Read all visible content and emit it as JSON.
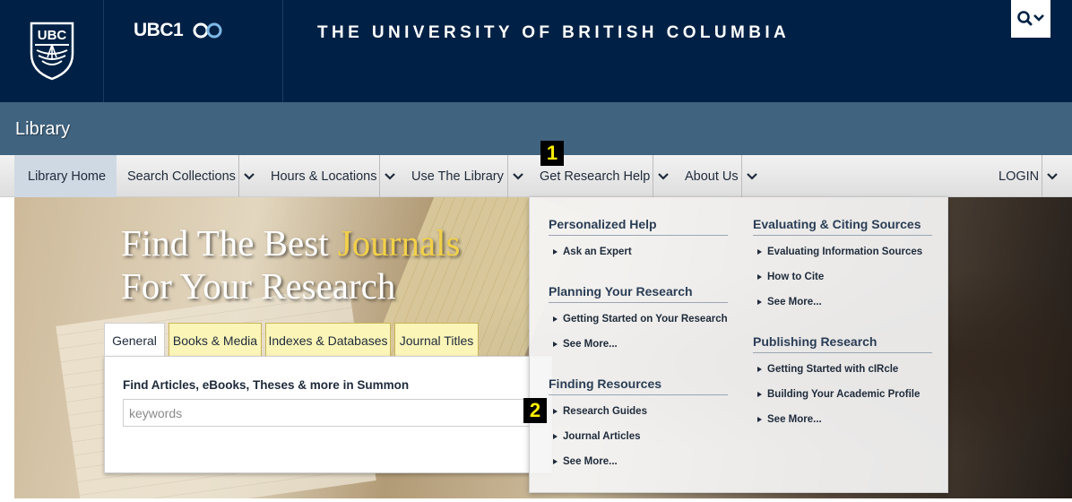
{
  "header": {
    "crest_text": "UBC",
    "ubc100_text": "UBC1",
    "university_title": "THE UNIVERSITY OF BRITISH COLUMBIA"
  },
  "library_bar": {
    "title": "Library"
  },
  "nav": {
    "items": [
      {
        "label": "Library Home"
      },
      {
        "label": "Search Collections"
      },
      {
        "label": "Hours & Locations"
      },
      {
        "label": "Use The Library"
      },
      {
        "label": "Get Research Help"
      },
      {
        "label": "About Us"
      }
    ],
    "login": "LOGIN"
  },
  "callouts": {
    "one": "1",
    "two": "2"
  },
  "hero": {
    "line1_start": "Find The Best ",
    "line1_highlight": "Journals",
    "line2": "For Your Research"
  },
  "search": {
    "tabs": [
      "General",
      "Books & Media",
      "Indexes & Databases",
      "Journal Titles"
    ],
    "label": "Find Articles, eBooks, Theses & more in Summon",
    "placeholder": "keywords"
  },
  "dropdown": {
    "personalized_help": {
      "heading": "Personalized Help",
      "links": [
        "Ask an Expert"
      ]
    },
    "planning_research": {
      "heading": "Planning Your Research",
      "links": [
        "Getting Started on Your Research",
        "See More..."
      ]
    },
    "finding_resources": {
      "heading": "Finding Resources",
      "links": [
        "Research Guides",
        "Journal Articles",
        "See More..."
      ]
    },
    "evaluating_citing": {
      "heading": "Evaluating & Citing Sources",
      "links": [
        "Evaluating Information Sources",
        "How to Cite",
        "See More..."
      ]
    },
    "publishing_research": {
      "heading": "Publishing Research",
      "links": [
        "Getting Started with cIRcle",
        "Building Your Academic Profile",
        "See More..."
      ]
    }
  },
  "colors": {
    "navy": "#002145",
    "library_bar": "#40637f",
    "highlight_gold": "#f2d04a",
    "callout_yellow": "#ffee00"
  }
}
